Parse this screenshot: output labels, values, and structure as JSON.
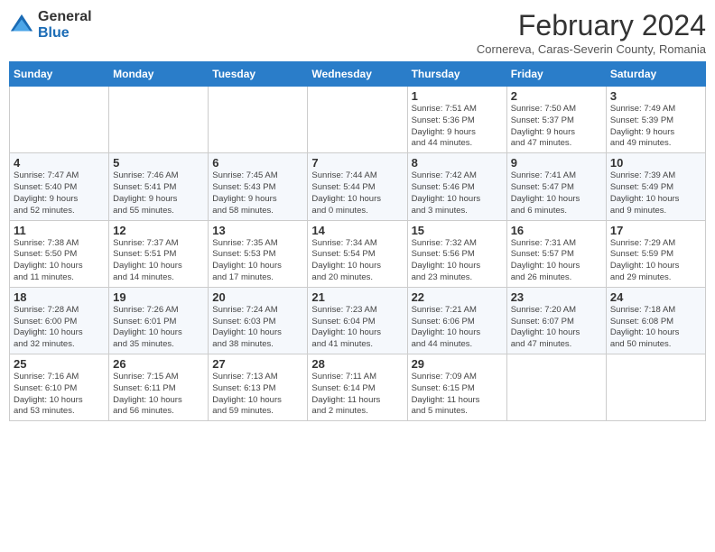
{
  "header": {
    "logo_general": "General",
    "logo_blue": "Blue",
    "title": "February 2024",
    "subtitle": "Cornereva, Caras-Severin County, Romania"
  },
  "weekdays": [
    "Sunday",
    "Monday",
    "Tuesday",
    "Wednesday",
    "Thursday",
    "Friday",
    "Saturday"
  ],
  "weeks": [
    [
      {
        "day": "",
        "info": ""
      },
      {
        "day": "",
        "info": ""
      },
      {
        "day": "",
        "info": ""
      },
      {
        "day": "",
        "info": ""
      },
      {
        "day": "1",
        "info": "Sunrise: 7:51 AM\nSunset: 5:36 PM\nDaylight: 9 hours\nand 44 minutes."
      },
      {
        "day": "2",
        "info": "Sunrise: 7:50 AM\nSunset: 5:37 PM\nDaylight: 9 hours\nand 47 minutes."
      },
      {
        "day": "3",
        "info": "Sunrise: 7:49 AM\nSunset: 5:39 PM\nDaylight: 9 hours\nand 49 minutes."
      }
    ],
    [
      {
        "day": "4",
        "info": "Sunrise: 7:47 AM\nSunset: 5:40 PM\nDaylight: 9 hours\nand 52 minutes."
      },
      {
        "day": "5",
        "info": "Sunrise: 7:46 AM\nSunset: 5:41 PM\nDaylight: 9 hours\nand 55 minutes."
      },
      {
        "day": "6",
        "info": "Sunrise: 7:45 AM\nSunset: 5:43 PM\nDaylight: 9 hours\nand 58 minutes."
      },
      {
        "day": "7",
        "info": "Sunrise: 7:44 AM\nSunset: 5:44 PM\nDaylight: 10 hours\nand 0 minutes."
      },
      {
        "day": "8",
        "info": "Sunrise: 7:42 AM\nSunset: 5:46 PM\nDaylight: 10 hours\nand 3 minutes."
      },
      {
        "day": "9",
        "info": "Sunrise: 7:41 AM\nSunset: 5:47 PM\nDaylight: 10 hours\nand 6 minutes."
      },
      {
        "day": "10",
        "info": "Sunrise: 7:39 AM\nSunset: 5:49 PM\nDaylight: 10 hours\nand 9 minutes."
      }
    ],
    [
      {
        "day": "11",
        "info": "Sunrise: 7:38 AM\nSunset: 5:50 PM\nDaylight: 10 hours\nand 11 minutes."
      },
      {
        "day": "12",
        "info": "Sunrise: 7:37 AM\nSunset: 5:51 PM\nDaylight: 10 hours\nand 14 minutes."
      },
      {
        "day": "13",
        "info": "Sunrise: 7:35 AM\nSunset: 5:53 PM\nDaylight: 10 hours\nand 17 minutes."
      },
      {
        "day": "14",
        "info": "Sunrise: 7:34 AM\nSunset: 5:54 PM\nDaylight: 10 hours\nand 20 minutes."
      },
      {
        "day": "15",
        "info": "Sunrise: 7:32 AM\nSunset: 5:56 PM\nDaylight: 10 hours\nand 23 minutes."
      },
      {
        "day": "16",
        "info": "Sunrise: 7:31 AM\nSunset: 5:57 PM\nDaylight: 10 hours\nand 26 minutes."
      },
      {
        "day": "17",
        "info": "Sunrise: 7:29 AM\nSunset: 5:59 PM\nDaylight: 10 hours\nand 29 minutes."
      }
    ],
    [
      {
        "day": "18",
        "info": "Sunrise: 7:28 AM\nSunset: 6:00 PM\nDaylight: 10 hours\nand 32 minutes."
      },
      {
        "day": "19",
        "info": "Sunrise: 7:26 AM\nSunset: 6:01 PM\nDaylight: 10 hours\nand 35 minutes."
      },
      {
        "day": "20",
        "info": "Sunrise: 7:24 AM\nSunset: 6:03 PM\nDaylight: 10 hours\nand 38 minutes."
      },
      {
        "day": "21",
        "info": "Sunrise: 7:23 AM\nSunset: 6:04 PM\nDaylight: 10 hours\nand 41 minutes."
      },
      {
        "day": "22",
        "info": "Sunrise: 7:21 AM\nSunset: 6:06 PM\nDaylight: 10 hours\nand 44 minutes."
      },
      {
        "day": "23",
        "info": "Sunrise: 7:20 AM\nSunset: 6:07 PM\nDaylight: 10 hours\nand 47 minutes."
      },
      {
        "day": "24",
        "info": "Sunrise: 7:18 AM\nSunset: 6:08 PM\nDaylight: 10 hours\nand 50 minutes."
      }
    ],
    [
      {
        "day": "25",
        "info": "Sunrise: 7:16 AM\nSunset: 6:10 PM\nDaylight: 10 hours\nand 53 minutes."
      },
      {
        "day": "26",
        "info": "Sunrise: 7:15 AM\nSunset: 6:11 PM\nDaylight: 10 hours\nand 56 minutes."
      },
      {
        "day": "27",
        "info": "Sunrise: 7:13 AM\nSunset: 6:13 PM\nDaylight: 10 hours\nand 59 minutes."
      },
      {
        "day": "28",
        "info": "Sunrise: 7:11 AM\nSunset: 6:14 PM\nDaylight: 11 hours\nand 2 minutes."
      },
      {
        "day": "29",
        "info": "Sunrise: 7:09 AM\nSunset: 6:15 PM\nDaylight: 11 hours\nand 5 minutes."
      },
      {
        "day": "",
        "info": ""
      },
      {
        "day": "",
        "info": ""
      }
    ]
  ]
}
